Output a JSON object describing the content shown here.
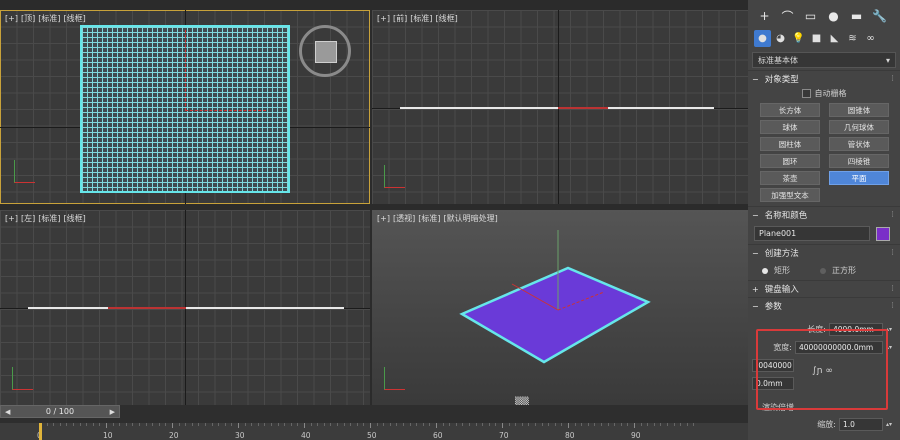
{
  "viewports": {
    "top": {
      "labels": [
        "[+]",
        "[顶]",
        "[标准]",
        "[线框]"
      ]
    },
    "front": {
      "labels": [
        "[+]",
        "[前]",
        "[标准]",
        "[线框]"
      ]
    },
    "left": {
      "labels": [
        "[+]",
        "[左]",
        "[标准]",
        "[线框]"
      ]
    },
    "persp": {
      "labels": [
        "[+]",
        "[透视]",
        "[标准]",
        "[默认明暗处理]"
      ]
    }
  },
  "command_panel": {
    "tabs": [
      "+",
      "⌒",
      "▭",
      "●",
      "▬",
      "🔧"
    ],
    "subtabs": [
      "●",
      "◕",
      "💡",
      "■",
      "◣",
      "≋",
      "∞"
    ],
    "category_dropdown": "标准基本体",
    "object_type": {
      "title": "对象类型",
      "autogrid": "自动栅格",
      "buttons": [
        "长方体",
        "圆锥体",
        "球体",
        "几何球体",
        "圆柱体",
        "管状体",
        "圆环",
        "四棱锥",
        "茶壶",
        "平面",
        "加强型文本"
      ],
      "active_button": "平面"
    },
    "name_color": {
      "title": "名称和颜色",
      "name": "Plane001",
      "color": "#7a2fc8"
    },
    "creation_method": {
      "title": "创建方法",
      "options": [
        "矩形",
        "正方形"
      ],
      "selected": "矩形"
    },
    "keyboard_entry": {
      "title": "键盘输入"
    },
    "params": {
      "title": "参数",
      "length_label": "长度:",
      "length": "4000.0mm",
      "width_label": "宽度:",
      "width": "40000000000.0mm",
      "partial1": ".0040000",
      "partial2": "0.0mm",
      "render_scale_label": "渲染倍增",
      "scale_label": "缩放:",
      "scale": "1.0"
    }
  },
  "timeline": {
    "frame": "0 / 100",
    "ticks": [
      "0",
      "10",
      "20",
      "30",
      "40",
      "50",
      "60",
      "70",
      "80",
      "90"
    ]
  }
}
